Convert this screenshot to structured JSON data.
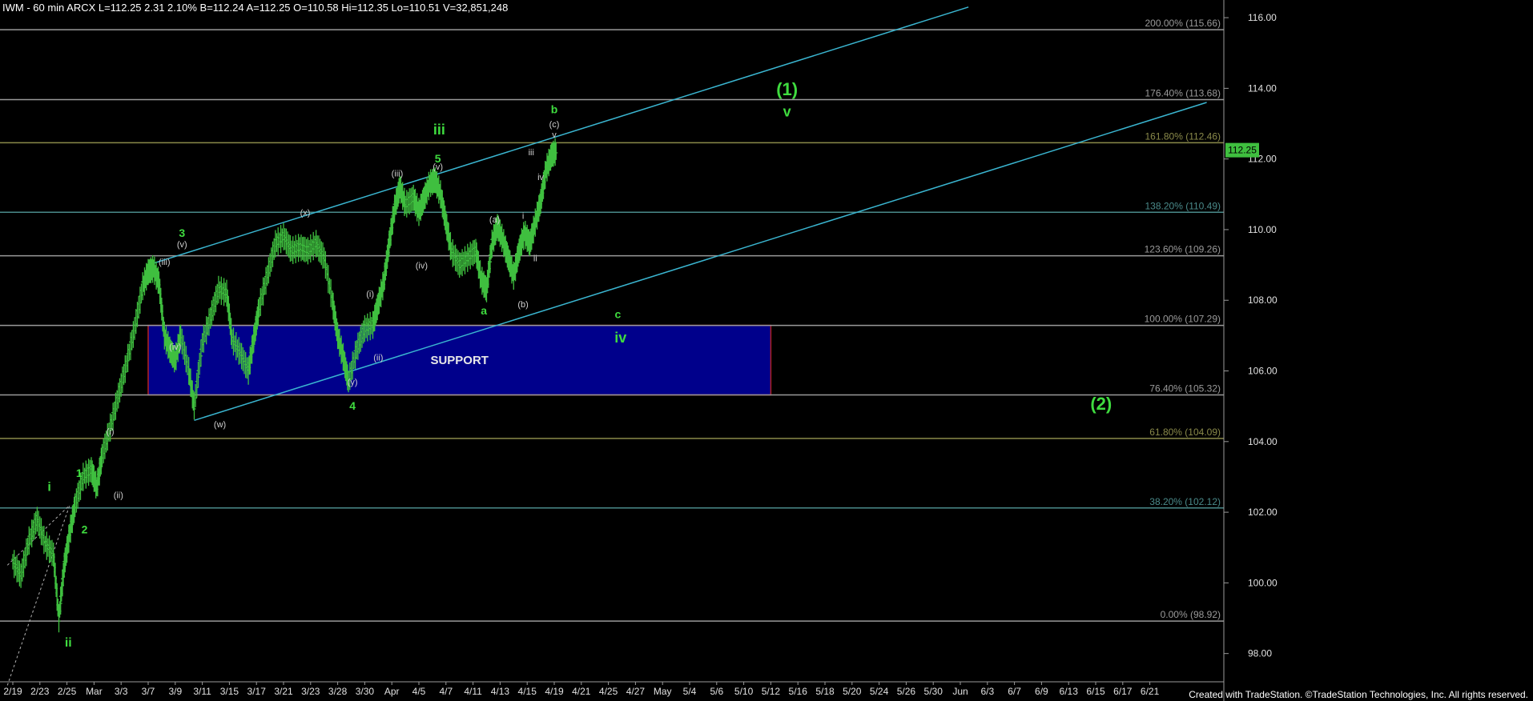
{
  "header_text": "IWM - 60 min  ARCX  L=112.25  2.31  2.10%  B=112.24  A=112.25  O=110.58  Hi=112.35  Lo=110.51  V=32,851,248",
  "footer_text": "Created with TradeStation. ©TradeStation Technologies, Inc. All rights reserved.",
  "colors": {
    "background": "#000000",
    "price_bars": "#3fbf3f",
    "wave_labels_major": "#3fdc3f",
    "wave_labels_minor": "#cfcfcf",
    "channel_lines": "#3ab5d0",
    "support_fill": "#00008b",
    "support_border": "#b22222",
    "last_price_tag": "#3fbf3f"
  },
  "chart_data": {
    "type": "line",
    "symbol": "IWM",
    "interval": "60 min",
    "ylim": [
      97.2,
      116.5
    ],
    "y_ticks": [
      98,
      100,
      102,
      104,
      106,
      108,
      110,
      112,
      114,
      116
    ],
    "y_tick_labels": [
      "98.00",
      "100.00",
      "102.00",
      "104.00",
      "106.00",
      "108.00",
      "110.00",
      "112.00",
      "114.00",
      "116.00"
    ],
    "x_tick_labels": [
      "2/19",
      "2/23",
      "2/25",
      "Mar",
      "3/3",
      "3/7",
      "3/9",
      "3/11",
      "3/15",
      "3/17",
      "3/21",
      "3/23",
      "3/28",
      "3/30",
      "Apr",
      "4/5",
      "4/7",
      "4/11",
      "4/13",
      "4/15",
      "4/19",
      "4/21",
      "4/25",
      "4/27",
      "May",
      "5/4",
      "5/6",
      "5/10",
      "5/12",
      "5/16",
      "5/18",
      "5/20",
      "5/24",
      "5/26",
      "5/30",
      "Jun",
      "6/3",
      "6/7",
      "6/9",
      "6/13",
      "6/15",
      "6/17",
      "6/21"
    ],
    "last_price_label": "112.25",
    "last_price": 112.25,
    "fib_levels": [
      {
        "label": "200.00% (115.66)",
        "value": 115.66,
        "color": "#9a9a9a"
      },
      {
        "label": "176.40% (113.68)",
        "value": 113.68,
        "color": "#9a9a9a"
      },
      {
        "label": "161.80% (112.46)",
        "value": 112.46,
        "color": "#8a8a4a"
      },
      {
        "label": "138.20% (110.49)",
        "value": 110.49,
        "color": "#4a8a8a"
      },
      {
        "label": "123.60% (109.26)",
        "value": 109.26,
        "color": "#9a9a9a"
      },
      {
        "label": "100.00% (107.29)",
        "value": 107.29,
        "color": "#9a9a9a"
      },
      {
        "label": "76.40% (105.32)",
        "value": 105.32,
        "color": "#9a9a9a"
      },
      {
        "label": "61.80% (104.09)",
        "value": 104.09,
        "color": "#8a8a4a"
      },
      {
        "label": "38.20% (102.12)",
        "value": 102.12,
        "color": "#4a8a8a"
      },
      {
        "label": "0.00% (98.92)",
        "value": 98.92,
        "color": "#9a9a9a"
      }
    ],
    "support_zone": {
      "label": "SUPPORT",
      "top": 107.29,
      "bottom": 105.32,
      "start_index": 5,
      "end_index": 28
    },
    "price_series": [
      [
        0,
        100.6
      ],
      [
        0.3,
        100.2
      ],
      [
        0.6,
        101.2
      ],
      [
        0.9,
        101.8
      ],
      [
        1.2,
        101.1
      ],
      [
        1.5,
        100.8
      ],
      [
        1.7,
        99.0
      ],
      [
        1.9,
        100.5
      ],
      [
        2.1,
        101.4
      ],
      [
        2.3,
        102.2
      ],
      [
        2.6,
        103.0
      ],
      [
        2.9,
        103.2
      ],
      [
        3.1,
        102.7
      ],
      [
        3.3,
        103.6
      ],
      [
        3.6,
        104.4
      ],
      [
        3.9,
        105.3
      ],
      [
        4.2,
        106.2
      ],
      [
        4.5,
        107.2
      ],
      [
        4.8,
        108.4
      ],
      [
        5.0,
        108.8
      ],
      [
        5.2,
        108.9
      ],
      [
        5.4,
        108.5
      ],
      [
        5.6,
        107.0
      ],
      [
        5.8,
        106.6
      ],
      [
        6.0,
        106.3
      ],
      [
        6.2,
        107.0
      ],
      [
        6.5,
        106.0
      ],
      [
        6.7,
        105.0
      ],
      [
        7.0,
        106.8
      ],
      [
        7.3,
        107.5
      ],
      [
        7.6,
        108.3
      ],
      [
        7.9,
        108.2
      ],
      [
        8.1,
        106.9
      ],
      [
        8.4,
        106.5
      ],
      [
        8.7,
        106.0
      ],
      [
        8.9,
        106.9
      ],
      [
        9.1,
        107.8
      ],
      [
        9.4,
        108.7
      ],
      [
        9.7,
        109.6
      ],
      [
        10.0,
        109.8
      ],
      [
        10.3,
        109.4
      ],
      [
        10.6,
        109.5
      ],
      [
        10.9,
        109.4
      ],
      [
        11.2,
        109.6
      ],
      [
        11.5,
        109.2
      ],
      [
        11.8,
        108.0
      ],
      [
        12.0,
        107.0
      ],
      [
        12.2,
        106.4
      ],
      [
        12.4,
        105.7
      ],
      [
        12.7,
        106.6
      ],
      [
        13.0,
        107.2
      ],
      [
        13.3,
        107.3
      ],
      [
        13.5,
        107.9
      ],
      [
        13.7,
        108.5
      ],
      [
        13.9,
        109.6
      ],
      [
        14.1,
        110.6
      ],
      [
        14.3,
        111.2
      ],
      [
        14.5,
        110.7
      ],
      [
        14.8,
        110.9
      ],
      [
        15.0,
        110.5
      ],
      [
        15.2,
        110.9
      ],
      [
        15.4,
        111.3
      ],
      [
        15.6,
        111.4
      ],
      [
        15.8,
        111.0
      ],
      [
        16.0,
        110.2
      ],
      [
        16.2,
        109.4
      ],
      [
        16.5,
        109.0
      ],
      [
        16.8,
        109.2
      ],
      [
        17.1,
        109.4
      ],
      [
        17.3,
        108.6
      ],
      [
        17.5,
        108.3
      ],
      [
        17.7,
        109.6
      ],
      [
        17.9,
        110.1
      ],
      [
        18.1,
        109.7
      ],
      [
        18.3,
        109.2
      ],
      [
        18.5,
        108.7
      ],
      [
        18.7,
        109.4
      ],
      [
        18.9,
        109.9
      ],
      [
        19.1,
        109.6
      ],
      [
        19.3,
        110.2
      ],
      [
        19.5,
        110.8
      ],
      [
        19.7,
        111.7
      ],
      [
        19.9,
        112.1
      ],
      [
        20.1,
        112.25
      ]
    ],
    "overlay_lines": [
      {
        "name": "upper-channel",
        "points": [
          [
            5.0,
            109.0
          ],
          [
            35.3,
            116.3
          ]
        ]
      },
      {
        "name": "lower-channel",
        "points": [
          [
            6.7,
            104.6
          ],
          [
            44.1,
            113.6
          ]
        ]
      },
      {
        "name": "dashed-line-1",
        "points": [
          [
            -0.2,
            97.1
          ],
          [
            2.1,
            102.2
          ]
        ]
      },
      {
        "name": "dashed-line-2",
        "points": [
          [
            -0.2,
            100.5
          ],
          [
            2.1,
            102.2
          ]
        ]
      }
    ],
    "annotations": [
      {
        "text": "i",
        "x": 1.35,
        "y": 102.6,
        "group": "major",
        "size": 16
      },
      {
        "text": "ii",
        "x": 2.05,
        "y": 98.2,
        "group": "major",
        "size": 16
      },
      {
        "text": "1",
        "x": 2.45,
        "y": 103.0,
        "group": "major",
        "size": 14
      },
      {
        "text": "2",
        "x": 2.65,
        "y": 101.4,
        "group": "major",
        "size": 14
      },
      {
        "text": "3",
        "x": 6.25,
        "y": 109.8,
        "group": "major",
        "size": 14
      },
      {
        "text": "4",
        "x": 12.55,
        "y": 104.9,
        "group": "major",
        "size": 14
      },
      {
        "text": "5",
        "x": 15.7,
        "y": 111.9,
        "group": "major",
        "size": 14
      },
      {
        "text": "iii",
        "x": 15.75,
        "y": 112.7,
        "group": "major",
        "size": 18
      },
      {
        "text": "a",
        "x": 17.4,
        "y": 107.6,
        "group": "major",
        "size": 14
      },
      {
        "text": "b",
        "x": 20.0,
        "y": 113.3,
        "group": "major",
        "size": 14
      },
      {
        "text": "c",
        "x": 22.35,
        "y": 107.5,
        "group": "major",
        "size": 14
      },
      {
        "text": "iv",
        "x": 22.45,
        "y": 106.8,
        "group": "major",
        "size": 18
      },
      {
        "text": "(1)",
        "x": 28.6,
        "y": 113.8,
        "group": "major",
        "size": 22
      },
      {
        "text": "v",
        "x": 28.6,
        "y": 113.2,
        "group": "major",
        "size": 18
      },
      {
        "text": "(2)",
        "x": 40.2,
        "y": 104.9,
        "group": "major",
        "size": 22
      },
      {
        "text": "(i)",
        "x": 3.6,
        "y": 104.2,
        "group": "minor",
        "size": 11
      },
      {
        "text": "(ii)",
        "x": 3.9,
        "y": 102.4,
        "group": "minor",
        "size": 11
      },
      {
        "text": "(iii)",
        "x": 5.6,
        "y": 109.0,
        "group": "minor",
        "size": 11
      },
      {
        "text": "(iv)",
        "x": 6.0,
        "y": 106.6,
        "group": "minor",
        "size": 11
      },
      {
        "text": "(v)",
        "x": 6.25,
        "y": 109.5,
        "group": "minor",
        "size": 11
      },
      {
        "text": "(w)",
        "x": 7.65,
        "y": 104.4,
        "group": "minor",
        "size": 11
      },
      {
        "text": "(x)",
        "x": 10.8,
        "y": 110.4,
        "group": "minor",
        "size": 11
      },
      {
        "text": "(y)",
        "x": 12.55,
        "y": 105.6,
        "group": "minor",
        "size": 11
      },
      {
        "text": "(i)",
        "x": 13.2,
        "y": 108.1,
        "group": "minor",
        "size": 11
      },
      {
        "text": "(ii)",
        "x": 13.5,
        "y": 106.3,
        "group": "minor",
        "size": 11
      },
      {
        "text": "(iii)",
        "x": 14.2,
        "y": 111.5,
        "group": "minor",
        "size": 11
      },
      {
        "text": "(iv)",
        "x": 15.1,
        "y": 108.9,
        "group": "minor",
        "size": 11
      },
      {
        "text": "(v)",
        "x": 15.7,
        "y": 111.7,
        "group": "minor",
        "size": 11
      },
      {
        "text": "(a)",
        "x": 17.8,
        "y": 110.2,
        "group": "minor",
        "size": 11
      },
      {
        "text": "(b)",
        "x": 18.85,
        "y": 107.8,
        "group": "minor",
        "size": 11
      },
      {
        "text": "i",
        "x": 18.85,
        "y": 110.3,
        "group": "minor",
        "size": 11
      },
      {
        "text": "ii",
        "x": 19.3,
        "y": 109.1,
        "group": "minor",
        "size": 11
      },
      {
        "text": "iii",
        "x": 19.15,
        "y": 112.1,
        "group": "minor",
        "size": 11
      },
      {
        "text": "iv",
        "x": 19.5,
        "y": 111.4,
        "group": "minor",
        "size": 11
      },
      {
        "text": "(c)",
        "x": 20.0,
        "y": 112.9,
        "group": "minor",
        "size": 11
      },
      {
        "text": "v",
        "x": 20.0,
        "y": 112.6,
        "group": "minor",
        "size": 11
      }
    ]
  }
}
